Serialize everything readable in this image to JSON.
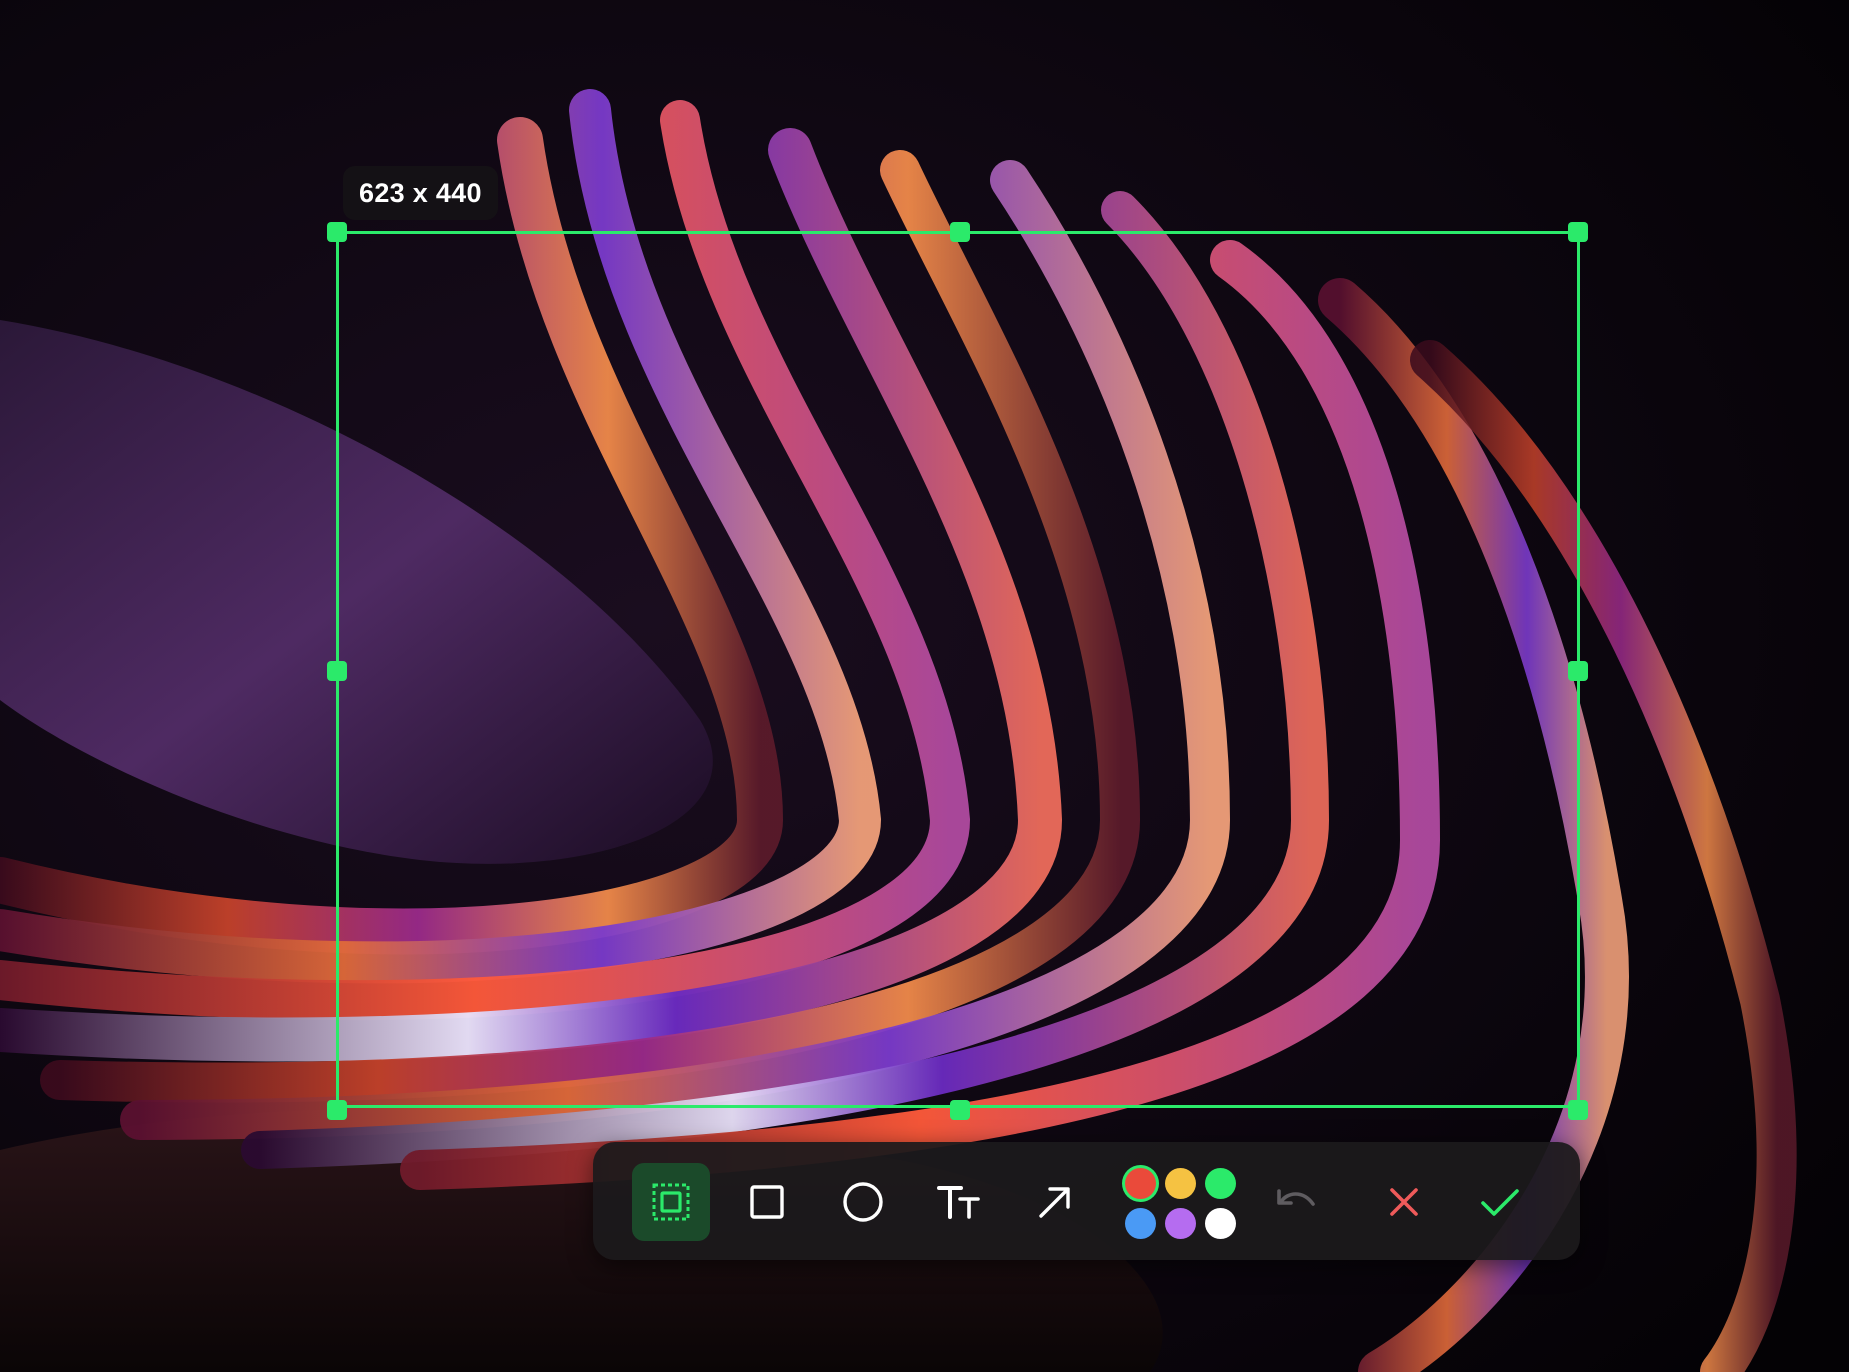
{
  "selection": {
    "size_label": "623 x 440",
    "border_color": "#2bea6a"
  },
  "toolbar": {
    "tools": [
      {
        "name": "select-region",
        "icon": "select-region-icon",
        "active": true
      },
      {
        "name": "rectangle",
        "icon": "rectangle-icon",
        "active": false
      },
      {
        "name": "ellipse",
        "icon": "circle-icon",
        "active": false
      },
      {
        "name": "text",
        "icon": "text-icon",
        "active": false
      },
      {
        "name": "arrow",
        "icon": "arrow-icon",
        "active": false
      }
    ],
    "colors": [
      {
        "name": "red",
        "hex": "#ea4a3a",
        "selected": true
      },
      {
        "name": "yellow",
        "hex": "#f5c242",
        "selected": false
      },
      {
        "name": "green",
        "hex": "#2bea6a",
        "selected": false
      },
      {
        "name": "blue",
        "hex": "#4a9af5",
        "selected": false
      },
      {
        "name": "purple",
        "hex": "#b56cf0",
        "selected": false
      },
      {
        "name": "white",
        "hex": "#ffffff",
        "selected": false
      }
    ],
    "actions": [
      {
        "name": "undo",
        "icon": "undo-icon",
        "enabled": false
      },
      {
        "name": "cancel",
        "icon": "close-icon",
        "color": "#ef5a5a"
      },
      {
        "name": "confirm",
        "icon": "check-icon",
        "color": "#2bea6a"
      }
    ]
  }
}
